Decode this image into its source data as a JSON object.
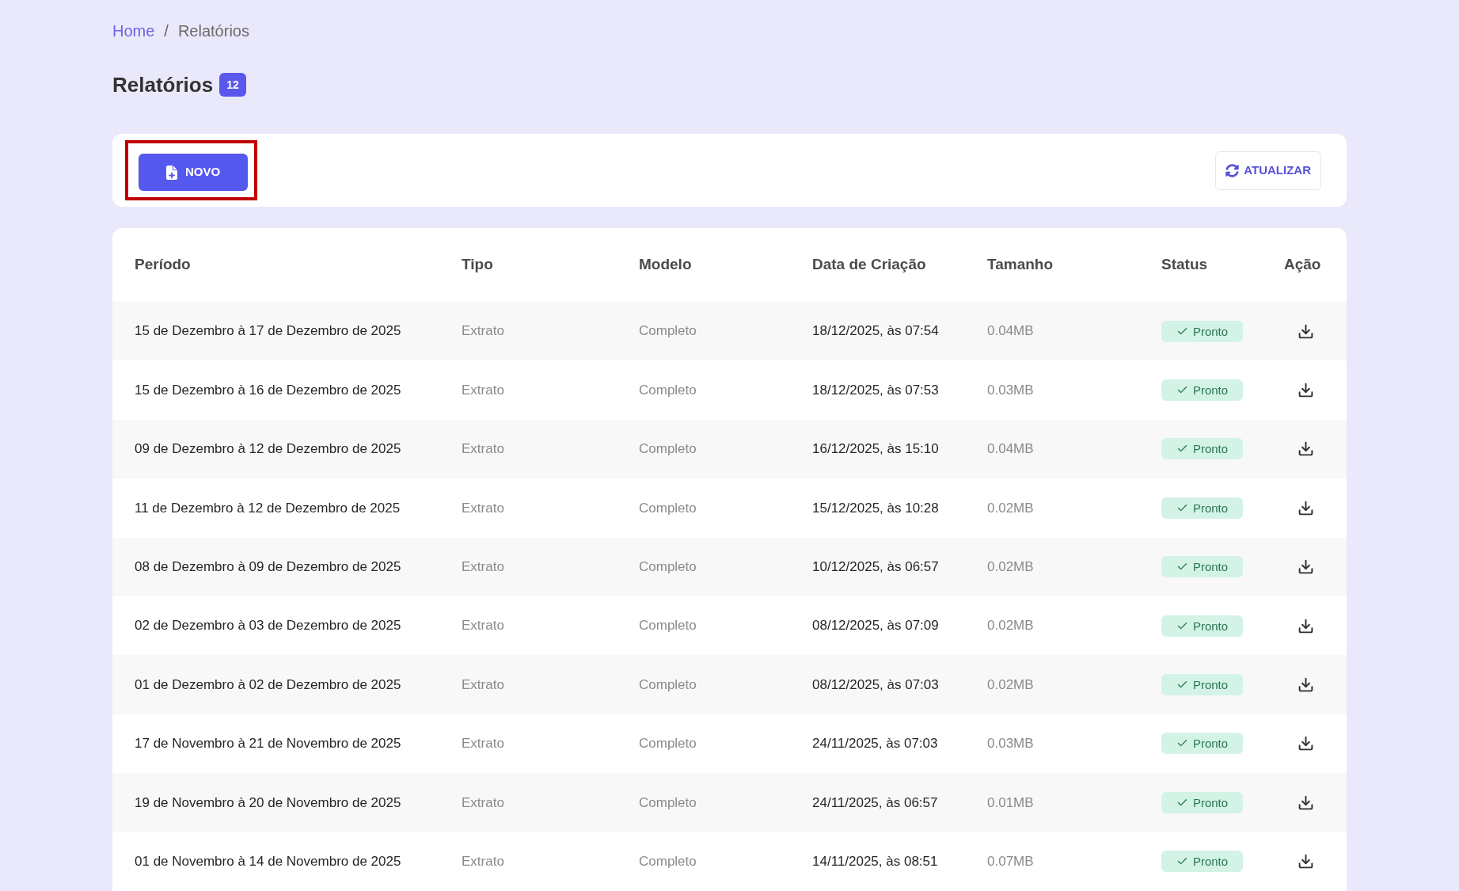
{
  "breadcrumb": {
    "separator": "/",
    "items": [
      {
        "label": "Home",
        "current": false
      },
      {
        "label": "Relatórios",
        "current": true
      }
    ]
  },
  "page": {
    "title": "Relatórios",
    "count": "12"
  },
  "toolbar": {
    "new_button": {
      "label": "NOVO",
      "highlighted": true
    },
    "refresh_button": {
      "label": "ATUALIZAR"
    }
  },
  "table": {
    "columns": [
      "Período",
      "Tipo",
      "Modelo",
      "Data de Criação",
      "Tamanho",
      "Status",
      "Ação"
    ],
    "rows": [
      {
        "period": "15 de Dezembro à 17 de Dezembro de 2025",
        "type": "Extrato",
        "model": "Completo",
        "created": "18/12/2025, às 07:54",
        "size": "0.04MB",
        "status": {
          "label": "Pronto",
          "kind": "ready"
        }
      },
      {
        "period": "15 de Dezembro à 16 de Dezembro de 2025",
        "type": "Extrato",
        "model": "Completo",
        "created": "18/12/2025, às 07:53",
        "size": "0.03MB",
        "status": {
          "label": "Pronto",
          "kind": "ready"
        }
      },
      {
        "period": "09 de Dezembro à 12 de Dezembro de 2025",
        "type": "Extrato",
        "model": "Completo",
        "created": "16/12/2025, às 15:10",
        "size": "0.04MB",
        "status": {
          "label": "Pronto",
          "kind": "ready"
        }
      },
      {
        "period": "11 de Dezembro à 12 de Dezembro de 2025",
        "type": "Extrato",
        "model": "Completo",
        "created": "15/12/2025, às 10:28",
        "size": "0.02MB",
        "status": {
          "label": "Pronto",
          "kind": "ready"
        }
      },
      {
        "period": "08 de Dezembro à 09 de Dezembro de 2025",
        "type": "Extrato",
        "model": "Completo",
        "created": "10/12/2025, às 06:57",
        "size": "0.02MB",
        "status": {
          "label": "Pronto",
          "kind": "ready"
        }
      },
      {
        "period": "02 de Dezembro à 03 de Dezembro de 2025",
        "type": "Extrato",
        "model": "Completo",
        "created": "08/12/2025, às 07:09",
        "size": "0.02MB",
        "status": {
          "label": "Pronto",
          "kind": "ready"
        }
      },
      {
        "period": "01 de Dezembro à 02 de Dezembro de 2025",
        "type": "Extrato",
        "model": "Completo",
        "created": "08/12/2025, às 07:03",
        "size": "0.02MB",
        "status": {
          "label": "Pronto",
          "kind": "ready"
        }
      },
      {
        "period": "17 de Novembro à 21 de Novembro de 2025",
        "type": "Extrato",
        "model": "Completo",
        "created": "24/11/2025, às 07:03",
        "size": "0.03MB",
        "status": {
          "label": "Pronto",
          "kind": "ready"
        }
      },
      {
        "period": "19 de Novembro à 20 de Novembro de 2025",
        "type": "Extrato",
        "model": "Completo",
        "created": "24/11/2025, às 06:57",
        "size": "0.01MB",
        "status": {
          "label": "Pronto",
          "kind": "ready"
        }
      },
      {
        "period": "01 de Novembro à 14 de Novembro de 2025",
        "type": "Extrato",
        "model": "Completo",
        "created": "14/11/2025, às 08:51",
        "size": "0.07MB",
        "status": {
          "label": "Pronto",
          "kind": "ready"
        }
      }
    ]
  }
}
